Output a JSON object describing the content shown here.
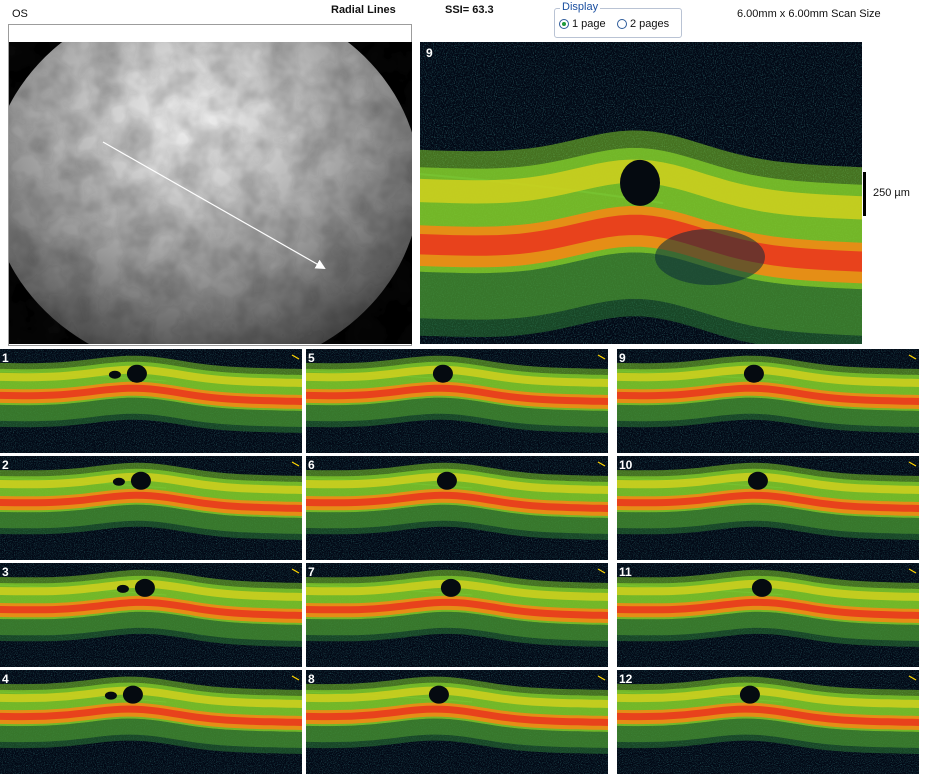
{
  "header": {
    "eye": "OS",
    "scan_type": "Radial Lines",
    "ssi": "SSI= 63.3",
    "scan_size": "6.00mm x 6.00mm Scan Size"
  },
  "display": {
    "legend": "Display",
    "options": [
      "1 page",
      "2 pages"
    ],
    "selected": "1 page"
  },
  "main_scan": {
    "number": "9",
    "scale_label": "250 µm"
  },
  "thumbnails": [
    "1",
    "2",
    "3",
    "4",
    "5",
    "6",
    "7",
    "8",
    "9",
    "10",
    "11",
    "12"
  ],
  "colors": {
    "background": "#020815",
    "retina_green": "#7ec82a",
    "rpe_red": "#e8421c",
    "rpe_orange": "#f28a14",
    "vitreous_line": "#3e9e83"
  }
}
